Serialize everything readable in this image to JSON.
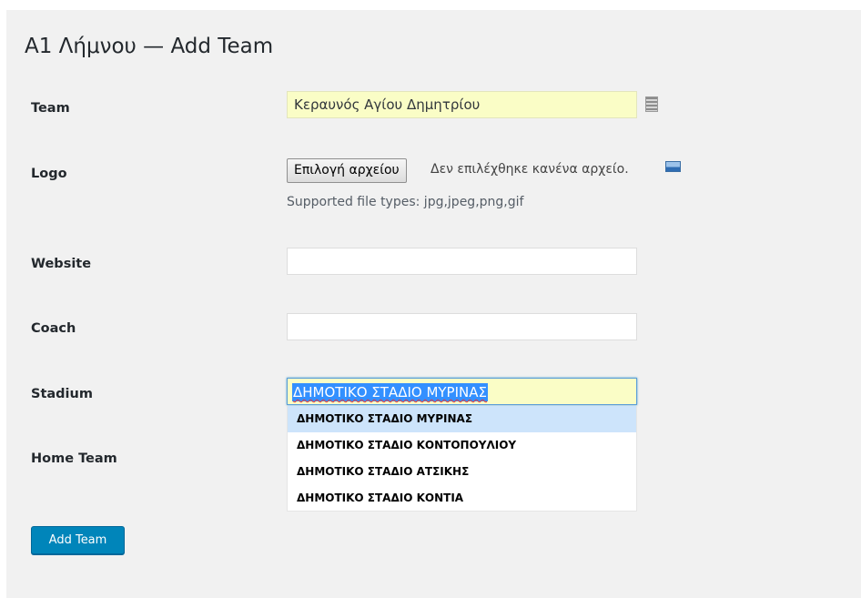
{
  "page": {
    "title": "A1 Λήμνου — Add Team"
  },
  "form": {
    "team": {
      "label": "Team",
      "value": "Κεραυνός Αγίου Δημητρίου",
      "icon": "database-icon"
    },
    "logo": {
      "label": "Logo",
      "button_label": "Επιλογή αρχείου",
      "status": "Δεν επιλέχθηκε κανένα αρχείο.",
      "hint": "Supported file types: jpg,jpeg,png,gif",
      "icon": "image-icon"
    },
    "website": {
      "label": "Website",
      "value": ""
    },
    "coach": {
      "label": "Coach",
      "value": ""
    },
    "stadium": {
      "label": "Stadium",
      "value": "ΔΗΜΟΤΙΚΟ ΣΤΑΔΙΟ ΜΥΡΙΝΑΣ",
      "suggestions": [
        "ΔΗΜΟΤΙΚΟ ΣΤΑΔΙΟ ΜΥΡΙΝΑΣ",
        "ΔΗΜΟΤΙΚΟ ΣΤΑΔΙΟ ΚΟΝΤΟΠΟΥΛΙΟΥ",
        "ΔΗΜΟΤΙΚΟ ΣΤΑΔΙΟ ΑΤΣΙΚΗΣ",
        "ΔΗΜΟΤΙΚΟ ΣΤΑΔΙΟ ΚΟΝΤΙΑ"
      ],
      "highlighted_suggestion": 0
    },
    "home_team": {
      "label": "Home Team"
    },
    "submit_label": "Add Team"
  },
  "colors": {
    "panel_background": "#f1f1f1",
    "autofill_background": "#fafdc6",
    "primary_button": "#0085ba",
    "suggestion_highlight": "#cde4fb",
    "text_selection": "#3390ff"
  }
}
